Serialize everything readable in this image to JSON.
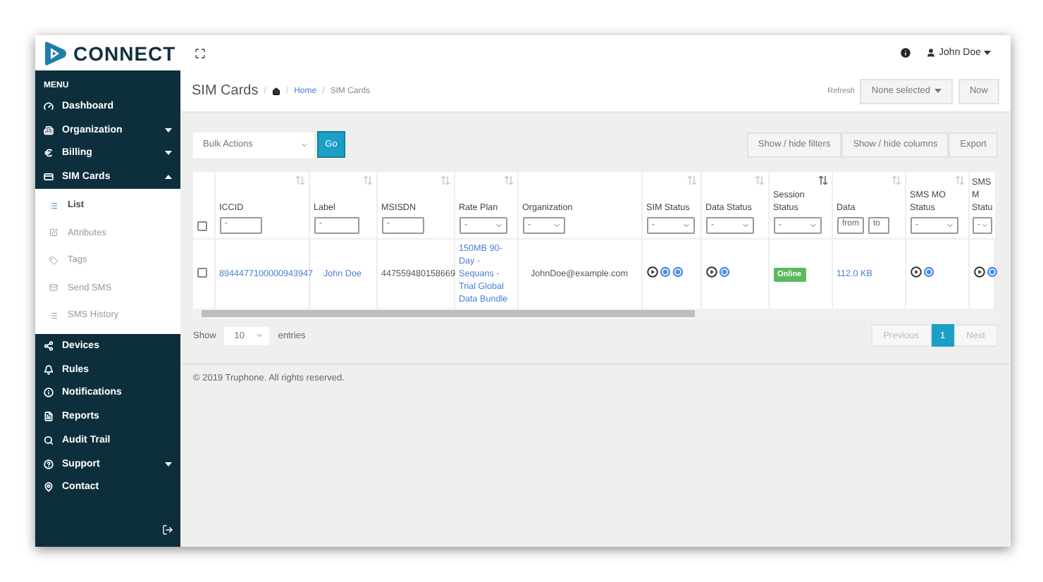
{
  "brand": {
    "name": "CONNECT"
  },
  "user": {
    "name": "John Doe"
  },
  "sidebar": {
    "heading": "MENU",
    "items": [
      {
        "label": "Dashboard"
      },
      {
        "label": "Organization",
        "expanded": false
      },
      {
        "label": "Billing",
        "expanded": false
      },
      {
        "label": "SIM Cards",
        "expanded": true,
        "children": [
          {
            "label": "List",
            "selected": true
          },
          {
            "label": "Attributes",
            "selected": false
          },
          {
            "label": "Tags",
            "selected": false
          },
          {
            "label": "Send SMS",
            "selected": false
          },
          {
            "label": "SMS History",
            "selected": false
          }
        ]
      },
      {
        "label": "Devices"
      },
      {
        "label": "Rules"
      },
      {
        "label": "Notifications"
      },
      {
        "label": "Reports"
      },
      {
        "label": "Audit Trail"
      },
      {
        "label": "Support",
        "expanded": false
      },
      {
        "label": "Contact"
      }
    ]
  },
  "page": {
    "title": "SIM Cards",
    "separator": "/",
    "breadcrumb": [
      "Home",
      "SIM Cards"
    ]
  },
  "refresh": {
    "label": "Refresh",
    "value": "None selected",
    "button": "Now"
  },
  "bulk": {
    "value": "Bulk Actions",
    "button": "Go"
  },
  "toolbar_buttons": [
    "Show / hide filters",
    "Show / hide columns",
    "Export"
  ],
  "table": {
    "columns": [
      {
        "kind": "checkbox",
        "checked": false
      },
      {
        "kind": "text",
        "label": "ICCID",
        "filter": "-",
        "sorted": false
      },
      {
        "kind": "text",
        "label": "Label",
        "filter": "-",
        "sorted": false
      },
      {
        "kind": "text",
        "label": "MSISDN",
        "filter": "-",
        "sorted": false
      },
      {
        "kind": "select",
        "label": "Rate Plan",
        "filter": "-",
        "sorted": false
      },
      {
        "kind": "select",
        "label": "Organization",
        "filter": "-"
      },
      {
        "kind": "select",
        "label": "SIM Status",
        "filter": "-",
        "sorted": false
      },
      {
        "kind": "select",
        "label": "Data Status",
        "filter": "-",
        "sorted": false
      },
      {
        "kind": "select",
        "label": "Session Status",
        "filter": "-",
        "sorted": true
      },
      {
        "kind": "range",
        "label": "Data",
        "from": "from",
        "to": "to",
        "sorted": false
      },
      {
        "kind": "select",
        "label": "SMS MO Status",
        "filter": "-",
        "sorted": false
      },
      {
        "kind": "select",
        "label": "SMS M Statu",
        "filter": "-"
      }
    ],
    "rows": [
      {
        "cells": [
          {
            "kind": "checkbox",
            "checked": false
          },
          {
            "kind": "link",
            "text": "8944477100000943947"
          },
          {
            "kind": "link",
            "text": "John Doe"
          },
          {
            "kind": "text",
            "text": "447559480158669"
          },
          {
            "kind": "link",
            "text": "150MB 90-Day - Sequans - Trial Global Data Bundle"
          },
          {
            "kind": "text",
            "text": "JohnDoe@example.com"
          },
          {
            "kind": "icons",
            "icons": [
              {
                "active": false
              },
              {
                "active": true
              },
              {
                "active": true
              }
            ]
          },
          {
            "kind": "icons",
            "icons": [
              {
                "active": false
              },
              {
                "active": true
              }
            ]
          },
          {
            "kind": "badge",
            "text": "Online"
          },
          {
            "kind": "link",
            "text": "112.0 KB"
          },
          {
            "kind": "icons",
            "icons": [
              {
                "active": false
              },
              {
                "active": true
              }
            ]
          },
          {
            "kind": "icons",
            "icons": [
              {
                "active": false
              },
              {
                "active": true
              }
            ]
          }
        ]
      }
    ]
  },
  "length": {
    "before": "Show",
    "value": "10",
    "after": "entries"
  },
  "pagination": [
    {
      "label": "Previous",
      "selected": false
    },
    {
      "label": "1",
      "selected": true
    },
    {
      "label": "Next",
      "selected": false
    }
  ],
  "footer": "© 2019 Truphone. All rights reserved."
}
